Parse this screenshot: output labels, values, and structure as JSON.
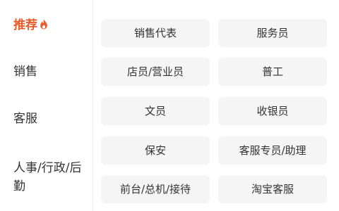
{
  "colors": {
    "accent": "#ea5a2a",
    "chip_background": "#f5f5f5",
    "text": "#333333",
    "sidebar_divider": "#eeeeee"
  },
  "sidebar": {
    "items": [
      {
        "label": "推荐",
        "icon": "fire-icon",
        "active": true
      },
      {
        "label": "销售",
        "active": false
      },
      {
        "label": "客服",
        "active": false
      },
      {
        "label": "人事/行政/后勤",
        "active": false
      }
    ]
  },
  "jobs": [
    "销售代表",
    "服务员",
    "店员/营业员",
    "普工",
    "文员",
    "收银员",
    "保安",
    "客服专员/助理",
    "前台/总机/接待",
    "淘宝客服"
  ]
}
